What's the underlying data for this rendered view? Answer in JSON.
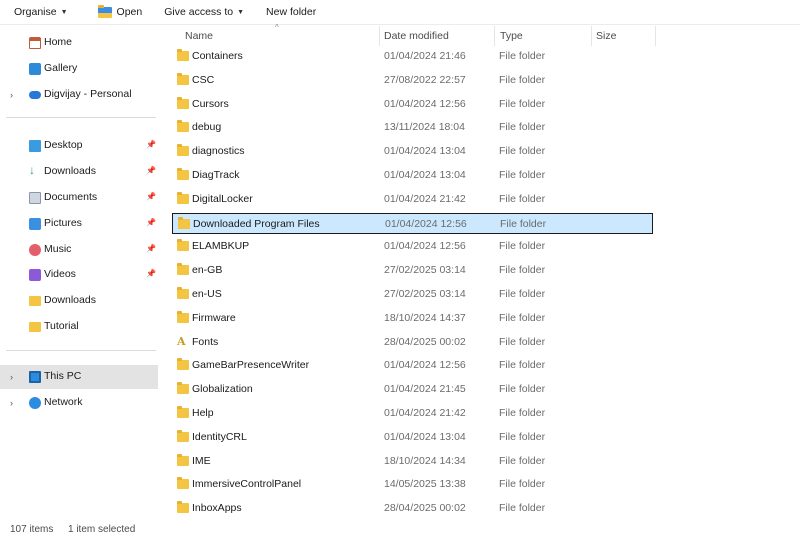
{
  "toolbar": {
    "organise": "Organise",
    "open": "Open",
    "give_access": "Give access to",
    "new_folder": "New folder"
  },
  "sidebar": {
    "items": [
      {
        "label": "Home",
        "icon": "home-icon"
      },
      {
        "label": "Gallery",
        "icon": "gallery-icon"
      },
      {
        "label": "Digvijay - Personal",
        "icon": "onedrive-cloud-icon"
      },
      {
        "label": "Desktop",
        "icon": "desktop-icon"
      },
      {
        "label": "Downloads",
        "icon": "download-arrow-icon"
      },
      {
        "label": "Documents",
        "icon": "documents-icon"
      },
      {
        "label": "Pictures",
        "icon": "pictures-icon"
      },
      {
        "label": "Music",
        "icon": "music-icon"
      },
      {
        "label": "Videos",
        "icon": "videos-icon"
      },
      {
        "label": "Downloads",
        "icon": "folder-icon"
      },
      {
        "label": "Tutorial",
        "icon": "folder-icon"
      },
      {
        "label": "This PC",
        "icon": "this-pc-icon"
      },
      {
        "label": "Network",
        "icon": "network-icon"
      }
    ],
    "selected": "This PC"
  },
  "columns": {
    "name": "Name",
    "date": "Date modified",
    "type": "Type",
    "size": "Size"
  },
  "files": [
    {
      "name": "Containers",
      "date": "01/04/2024 21:46",
      "type": "File folder"
    },
    {
      "name": "CSC",
      "date": "27/08/2022 22:57",
      "type": "File folder"
    },
    {
      "name": "Cursors",
      "date": "01/04/2024 12:56",
      "type": "File folder"
    },
    {
      "name": "debug",
      "date": "13/11/2024 18:04",
      "type": "File folder"
    },
    {
      "name": "diagnostics",
      "date": "01/04/2024 13:04",
      "type": "File folder"
    },
    {
      "name": "DiagTrack",
      "date": "01/04/2024 13:04",
      "type": "File folder"
    },
    {
      "name": "DigitalLocker",
      "date": "01/04/2024 21:42",
      "type": "File folder"
    },
    {
      "name": "Downloaded Program Files",
      "date": "01/04/2024 12:56",
      "type": "File folder"
    },
    {
      "name": "ELAMBKUP",
      "date": "01/04/2024 12:56",
      "type": "File folder"
    },
    {
      "name": "en-GB",
      "date": "27/02/2025 03:14",
      "type": "File folder"
    },
    {
      "name": "en-US",
      "date": "27/02/2025 03:14",
      "type": "File folder"
    },
    {
      "name": "Firmware",
      "date": "18/10/2024 14:37",
      "type": "File folder"
    },
    {
      "name": "Fonts",
      "date": "28/04/2025 00:02",
      "type": "File folder"
    },
    {
      "name": "GameBarPresenceWriter",
      "date": "01/04/2024 12:56",
      "type": "File folder"
    },
    {
      "name": "Globalization",
      "date": "01/04/2024 21:45",
      "type": "File folder"
    },
    {
      "name": "Help",
      "date": "01/04/2024 21:42",
      "type": "File folder"
    },
    {
      "name": "IdentityCRL",
      "date": "01/04/2024 13:04",
      "type": "File folder"
    },
    {
      "name": "IME",
      "date": "18/10/2024 14:34",
      "type": "File folder"
    },
    {
      "name": "ImmersiveControlPanel",
      "date": "14/05/2025 13:38",
      "type": "File folder"
    },
    {
      "name": "InboxApps",
      "date": "28/04/2025 00:02",
      "type": "File folder"
    }
  ],
  "selected_file": "Downloaded Program Files",
  "status": {
    "items": "107 items",
    "selected": "1 item selected"
  }
}
